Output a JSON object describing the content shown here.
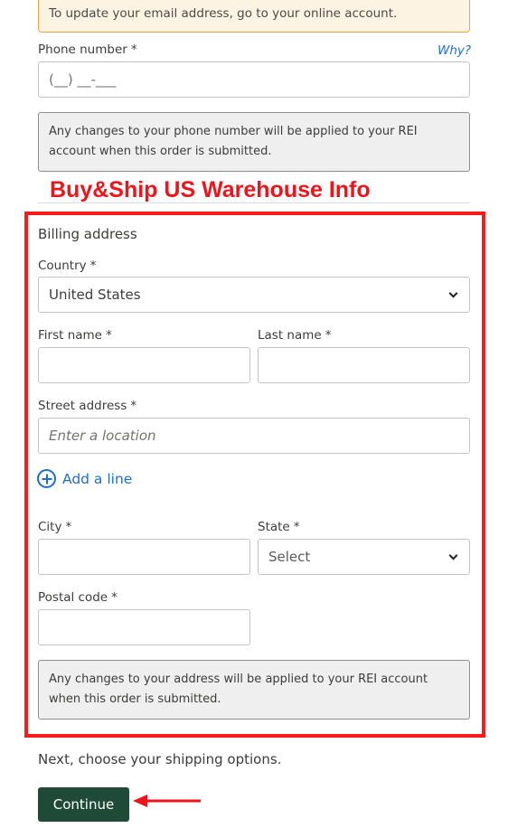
{
  "email_notice": "To update your email address, go to your online account.",
  "phone": {
    "label": "Phone number",
    "required_mark": "*",
    "why_link": "Why?",
    "placeholder": "(__) __-___",
    "notice": "Any changes to your phone number will be applied to your REI account when this order is submitted."
  },
  "annotation": {
    "title": "Buy&Ship US Warehouse Info",
    "color": "#f0141a"
  },
  "billing": {
    "title": "Billing address",
    "country": {
      "label": "Country",
      "required_mark": "*",
      "value": "United States"
    },
    "first_name": {
      "label": "First name",
      "required_mark": "*",
      "value": ""
    },
    "last_name": {
      "label": "Last name",
      "required_mark": "*",
      "value": ""
    },
    "street": {
      "label": "Street address",
      "required_mark": "*",
      "placeholder": "Enter a location"
    },
    "add_line": "Add a line",
    "city": {
      "label": "City",
      "required_mark": "*",
      "value": ""
    },
    "state": {
      "label": "State",
      "required_mark": "*",
      "value": "Select"
    },
    "postal": {
      "label": "Postal code",
      "required_mark": "*",
      "value": ""
    },
    "notice": "Any changes to your address will be applied to your REI account when this order is submitted."
  },
  "next_text": "Next, choose your shipping options.",
  "continue_label": "Continue",
  "colors": {
    "primary_button": "#1f4a37",
    "link": "#1c6fd1",
    "annotation_red": "#fb1a1a"
  }
}
